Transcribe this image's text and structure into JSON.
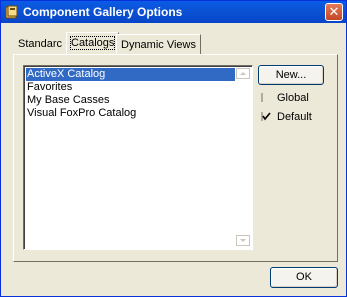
{
  "window": {
    "title": "Component Gallery Options",
    "close_glyph": "✕"
  },
  "tabs": [
    {
      "label": "Standarc",
      "active": false
    },
    {
      "label": "Catalogs",
      "active": true
    },
    {
      "label": "Dynamic Views",
      "active": false
    }
  ],
  "catalogs": {
    "items": [
      {
        "label": "ActiveX Catalog",
        "selected": true
      },
      {
        "label": "Favorites",
        "selected": false
      },
      {
        "label": "My Base Casses",
        "selected": false
      },
      {
        "label": "Visual FoxPro Catalog",
        "selected": false
      }
    ],
    "new_button": "New...",
    "global_label": "Global",
    "global_checked": false,
    "default_label": "Default",
    "default_checked": true
  },
  "footer": {
    "ok_button": "OK"
  },
  "colors": {
    "titlebar": "#0a5ce6",
    "selection": "#316ac5",
    "dialog_bg": "#ece9d8"
  }
}
